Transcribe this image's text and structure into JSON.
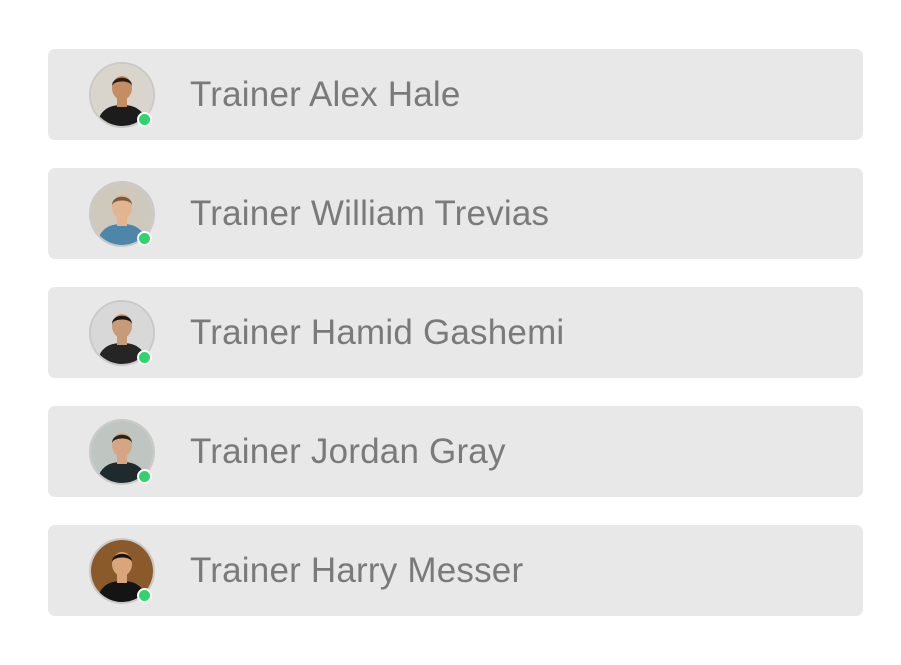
{
  "trainers": [
    {
      "name": "Trainer Alex Hale",
      "status": "online",
      "avatar": {
        "bg": "#d9d4cc",
        "skin": "#c58d62",
        "hair": "#2a1e17",
        "shirt": "#1c1c1c"
      }
    },
    {
      "name": "Trainer William Trevias",
      "status": "online",
      "avatar": {
        "bg": "#cfc8bd",
        "skin": "#e2b48f",
        "hair": "#7a5a3c",
        "shirt": "#4d86a8"
      }
    },
    {
      "name": "Trainer Hamid Gashemi",
      "status": "online",
      "avatar": {
        "bg": "#d8d8d8",
        "skin": "#c79a78",
        "hair": "#1c1612",
        "shirt": "#252525"
      }
    },
    {
      "name": "Trainer Jordan Gray",
      "status": "online",
      "avatar": {
        "bg": "#bfc6c1",
        "skin": "#d5a684",
        "hair": "#2b211a",
        "shirt": "#1f2a2c"
      }
    },
    {
      "name": "Trainer Harry Messer",
      "status": "online",
      "avatar": {
        "bg": "#8a5a2b",
        "skin": "#d8a67a",
        "hair": "#1a1410",
        "shirt": "#141414"
      }
    }
  ],
  "colors": {
    "row_bg": "#e8e8e8",
    "name_text": "#7a7a7a",
    "online": "#2fd56a"
  }
}
